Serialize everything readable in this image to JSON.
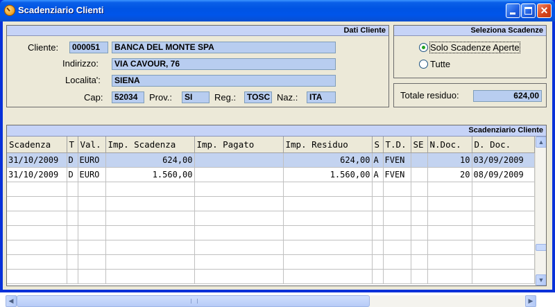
{
  "window": {
    "title": "Scadenziario Clienti"
  },
  "dati_cliente": {
    "header": "Dati Cliente",
    "cliente_label": "Cliente:",
    "cliente_code": "000051",
    "cliente_name": "BANCA DEL MONTE SPA",
    "indirizzo_label": "Indirizzo:",
    "indirizzo": "VIA CAVOUR, 76",
    "localita_label": "Localita':",
    "localita": "SIENA",
    "cap_label": "Cap:",
    "cap": "52034",
    "prov_label": "Prov.:",
    "prov": "SI",
    "reg_label": "Reg.:",
    "reg": "TOSC",
    "naz_label": "Naz.:",
    "naz": "ITA"
  },
  "seleziona": {
    "header": "Seleziona Scadenze",
    "options": [
      {
        "label": "Solo Scadenze Aperte",
        "selected": true
      },
      {
        "label": "Tutte",
        "selected": false
      }
    ]
  },
  "totale": {
    "label": "Totale residuo:",
    "value": "624,00"
  },
  "grid": {
    "header": "Scadenziario Cliente",
    "columns": [
      "Scadenza",
      "T",
      "Val.",
      "Imp. Scadenza",
      "Imp. Pagato",
      "Imp. Residuo",
      "S",
      "T.D.",
      "SE",
      "N.Doc.",
      "D. Doc."
    ],
    "rows": [
      [
        "31/10/2009",
        "D",
        "EURO",
        "624,00",
        "",
        "624,00",
        "A",
        "FVEN",
        "",
        "10",
        "03/09/2009"
      ],
      [
        "31/10/2009",
        "D",
        "EURO",
        "1.560,00",
        "",
        "1.560,00",
        "A",
        "FVEN",
        "",
        "20",
        "08/09/2009"
      ]
    ],
    "selected_row": 0,
    "empty_rows": 7
  }
}
